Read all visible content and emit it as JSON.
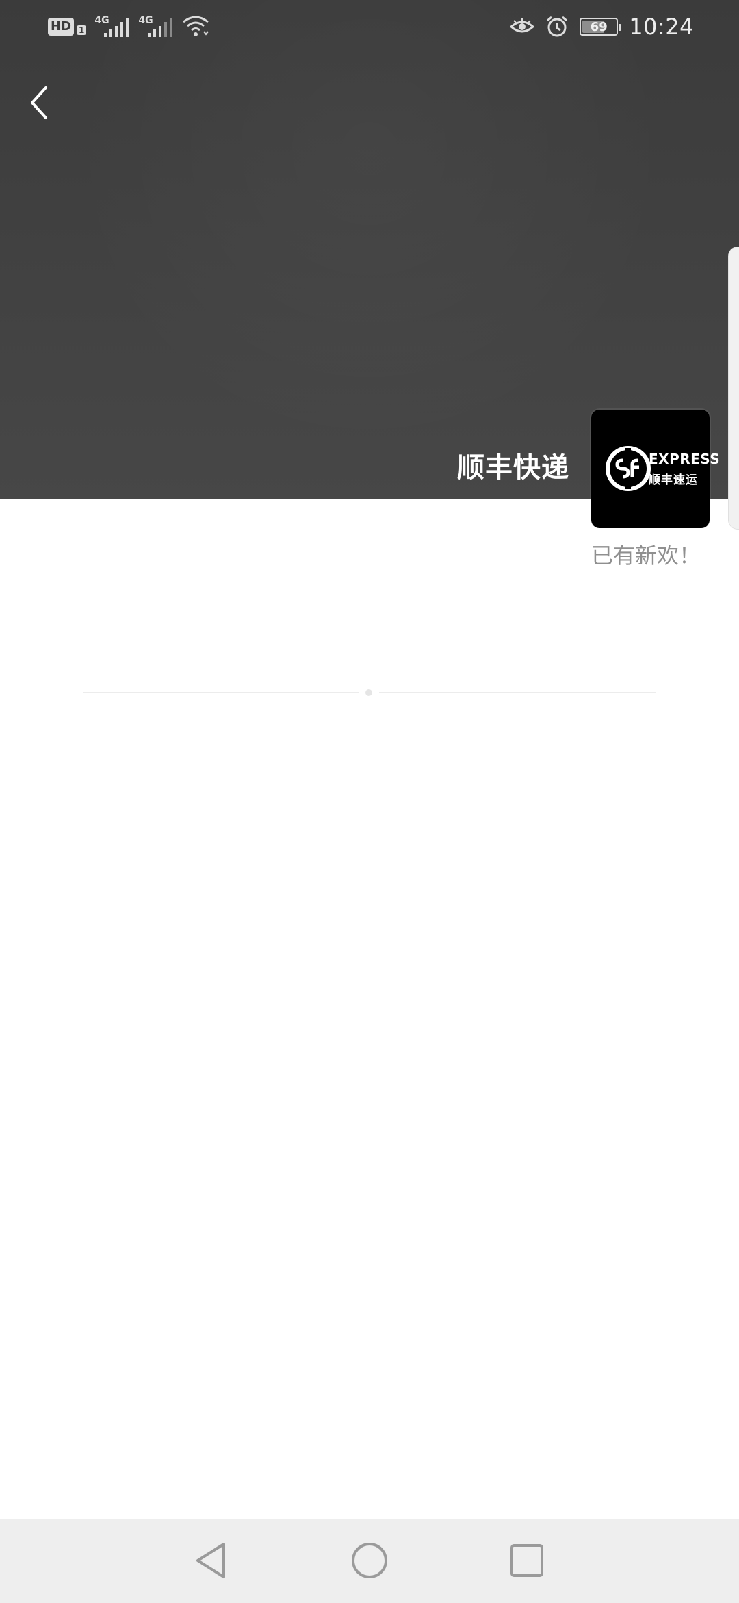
{
  "status_bar": {
    "hd_label": "HD",
    "sim_index": "1",
    "sim1_network": "4G",
    "sim2_network": "4G",
    "battery_level": "69",
    "battery_fraction": 0.69,
    "time": "10:24",
    "icons": [
      "eye-comfort-icon",
      "alarm-icon",
      "wifi-icon",
      "signal-icon",
      "battery-icon"
    ]
  },
  "header": {
    "back_icon": "chevron-left-icon",
    "title": "顺丰快递",
    "tagline": "已有新欢！"
  },
  "logo": {
    "express_text": "EXPRESS",
    "cn_text": "顺丰速运",
    "bg_color": "#000000"
  },
  "nav_bar": {
    "icons": [
      "back-triangle-icon",
      "home-circle-icon",
      "recents-square-icon"
    ]
  },
  "colors": {
    "cover": "#424242",
    "tagline": "#8f8f8f",
    "nav_bg": "#eeeeee"
  }
}
